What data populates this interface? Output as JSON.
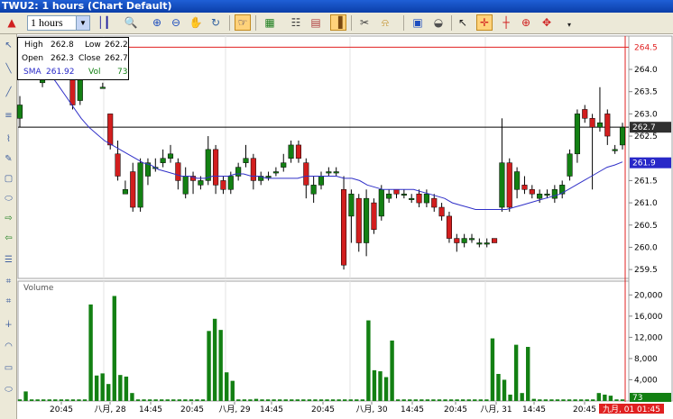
{
  "window": {
    "title": "TWU2: 1 hours (Chart Default)"
  },
  "toolbar": {
    "interval": "1 hours",
    "buttons": [
      "pin-icon",
      "bar-type-icon",
      "zoom-icon",
      "zoom-in-icon",
      "zoom-out-icon",
      "pan-icon",
      "refresh-icon",
      "cursor-icon",
      "indicator-icon",
      "grid-icon",
      "color-icon",
      "scissors-icon",
      "alert-icon",
      "save-icon",
      "eraser-icon",
      "pointer-icon",
      "crosshair-icon",
      "cross-red-icon",
      "cross-dot-icon",
      "cross-arrow-icon"
    ]
  },
  "info": {
    "high_label": "High",
    "high": "262.8",
    "low_label": "Low",
    "low": "262.2",
    "open_label": "Open",
    "open": "262.3",
    "close_label": "Close",
    "close": "262.7",
    "sma_label": "SMA",
    "sma": "261.92",
    "vol_label": "Vol",
    "vol": "73"
  },
  "price_axis": {
    "ticks": [
      "264.0",
      "263.5",
      "263.0",
      "262.5",
      "261.5",
      "261.0",
      "260.5",
      "260.0",
      "259.5"
    ],
    "last_close": "262.7",
    "sma_tag": "261.9",
    "alert": "264.5"
  },
  "volume_axis": {
    "ticks": [
      "20,000",
      "16,000",
      "12,000",
      "8,000",
      "4,000"
    ],
    "last": "73"
  },
  "volume_label": "Volume",
  "time_axis": [
    "20:45",
    "八月, 28",
    "14:45",
    "20:45",
    "八月, 29",
    "14:45",
    "20:45",
    "八月, 30",
    "14:45",
    "20:45",
    "八月, 31",
    "14:45",
    "20:45"
  ],
  "time_cursor": "九月, 01 01:45",
  "colors": {
    "up": "#138013",
    "down": "#d21e1e",
    "sma": "#3030c8",
    "volume": "#138013",
    "alert": "#e02020",
    "close_tag": "#303030",
    "sma_tag": "#2828c8"
  },
  "chart_data": {
    "type": "candlestick",
    "ylim": [
      259.3,
      264.75
    ],
    "ohlc": [
      [
        262.9,
        263.2,
        262.7,
        263.4
      ],
      [
        264.1,
        264.3,
        264.0,
        264.5
      ],
      [
        264.1,
        263.9,
        263.8,
        264.2
      ],
      [
        263.7,
        264.0,
        263.6,
        264.1
      ],
      [
        264.3,
        264.3,
        264.3,
        264.4
      ],
      [
        264.3,
        264.3,
        264.3,
        264.4
      ],
      [
        264.1,
        264.1,
        264.0,
        264.3
      ],
      [
        263.9,
        263.2,
        263.1,
        264.4
      ],
      [
        263.3,
        263.8,
        263.2,
        264.1
      ],
      [
        264.4,
        264.2,
        264.1,
        264.5
      ],
      [
        264.5,
        264.6,
        264.0,
        264.7
      ],
      [
        263.6,
        263.6,
        263.6,
        263.7
      ],
      [
        263.0,
        262.3,
        262.2,
        263.0
      ],
      [
        262.1,
        261.6,
        261.5,
        262.4
      ],
      [
        261.2,
        261.3,
        261.2,
        261.5
      ],
      [
        261.7,
        260.9,
        260.8,
        261.9
      ],
      [
        260.9,
        261.9,
        260.8,
        262.0
      ],
      [
        261.6,
        261.9,
        261.4,
        262.0
      ],
      [
        261.8,
        261.8,
        261.7,
        262.0
      ],
      [
        261.9,
        262.0,
        261.8,
        262.2
      ],
      [
        262.0,
        262.1,
        261.9,
        262.3
      ],
      [
        261.9,
        261.5,
        261.3,
        262.0
      ],
      [
        261.2,
        261.6,
        261.1,
        261.8
      ],
      [
        261.6,
        261.5,
        261.2,
        261.7
      ],
      [
        261.4,
        261.5,
        261.3,
        261.6
      ],
      [
        261.5,
        262.2,
        261.4,
        262.5
      ],
      [
        262.2,
        261.4,
        261.2,
        262.3
      ],
      [
        261.5,
        261.3,
        261.2,
        261.6
      ],
      [
        261.3,
        261.6,
        261.2,
        261.7
      ],
      [
        261.6,
        261.8,
        261.5,
        261.9
      ],
      [
        261.9,
        262.0,
        261.8,
        262.3
      ],
      [
        262.0,
        261.5,
        261.3,
        262.1
      ],
      [
        261.5,
        261.6,
        261.4,
        261.7
      ],
      [
        261.6,
        261.6,
        261.5,
        261.7
      ],
      [
        261.7,
        261.7,
        261.6,
        261.8
      ],
      [
        261.8,
        261.9,
        261.7,
        262.1
      ],
      [
        262.0,
        262.3,
        261.9,
        262.4
      ],
      [
        262.3,
        262.0,
        261.9,
        262.4
      ],
      [
        261.9,
        261.4,
        261.1,
        262.0
      ],
      [
        261.2,
        261.4,
        261.0,
        261.6
      ],
      [
        261.4,
        261.6,
        261.3,
        261.7
      ],
      [
        261.7,
        261.7,
        261.6,
        261.8
      ],
      [
        261.7,
        261.7,
        261.6,
        261.8
      ],
      [
        261.3,
        259.6,
        259.5,
        261.6
      ],
      [
        260.7,
        261.2,
        260.1,
        261.3
      ],
      [
        261.1,
        260.1,
        259.9,
        261.2
      ],
      [
        260.1,
        261.1,
        259.8,
        261.3
      ],
      [
        261.0,
        260.4,
        260.3,
        261.1
      ],
      [
        260.7,
        261.3,
        260.6,
        261.4
      ],
      [
        261.1,
        261.2,
        261.0,
        261.3
      ],
      [
        261.3,
        261.2,
        261.1,
        261.3
      ],
      [
        261.2,
        261.2,
        261.1,
        261.3
      ],
      [
        261.1,
        261.1,
        261.0,
        261.2
      ],
      [
        261.2,
        261.0,
        260.9,
        261.3
      ],
      [
        261.0,
        261.2,
        260.9,
        261.3
      ],
      [
        261.1,
        260.9,
        260.8,
        261.2
      ],
      [
        260.9,
        260.7,
        260.6,
        261.0
      ],
      [
        260.7,
        260.2,
        260.1,
        260.8
      ],
      [
        260.2,
        260.1,
        259.9,
        260.3
      ],
      [
        260.1,
        260.2,
        260.0,
        260.3
      ],
      [
        260.2,
        260.2,
        260.1,
        260.3
      ],
      [
        260.1,
        260.1,
        260.0,
        260.2
      ],
      [
        260.1,
        260.1,
        260.0,
        260.2
      ],
      [
        260.2,
        260.1,
        260.1,
        260.2
      ],
      [
        260.9,
        261.9,
        260.8,
        262.9
      ],
      [
        261.9,
        260.9,
        260.8,
        262.0
      ],
      [
        261.3,
        261.7,
        261.1,
        261.8
      ],
      [
        261.4,
        261.3,
        261.2,
        261.6
      ],
      [
        261.3,
        261.2,
        261.1,
        261.4
      ],
      [
        261.1,
        261.2,
        261.0,
        261.3
      ],
      [
        261.2,
        261.2,
        261.1,
        261.3
      ],
      [
        261.1,
        261.3,
        261.0,
        261.4
      ],
      [
        261.2,
        261.4,
        261.1,
        261.5
      ],
      [
        261.6,
        262.1,
        261.5,
        262.2
      ],
      [
        262.1,
        263.0,
        261.9,
        263.1
      ],
      [
        263.1,
        262.9,
        262.8,
        263.2
      ],
      [
        262.9,
        262.7,
        261.3,
        263.0
      ],
      [
        262.7,
        262.8,
        262.6,
        263.6
      ],
      [
        263.0,
        262.5,
        262.3,
        263.1
      ],
      [
        262.2,
        262.2,
        262.1,
        262.3
      ],
      [
        262.3,
        262.7,
        262.2,
        262.8
      ]
    ],
    "sma": [
      264.0,
      264.15,
      264.1,
      263.9,
      263.65,
      263.4,
      263.15,
      262.9,
      262.7,
      262.55,
      262.4,
      262.3,
      262.2,
      262.1,
      262.0,
      261.9,
      261.85,
      261.75,
      261.7,
      261.65,
      261.6,
      261.6,
      261.55,
      261.55,
      261.6,
      261.6,
      261.6,
      261.65,
      261.65,
      261.6,
      261.6,
      261.55,
      261.55,
      261.55,
      261.55,
      261.55,
      261.6,
      261.6,
      261.6,
      261.6,
      261.6,
      261.55,
      261.55,
      261.5,
      261.4,
      261.35,
      261.3,
      261.3,
      261.3,
      261.3,
      261.3,
      261.25,
      261.2,
      261.15,
      261.1,
      261.0,
      260.95,
      260.9,
      260.85,
      260.85,
      260.85,
      260.85,
      260.85,
      260.9,
      260.95,
      261.0,
      261.05,
      261.1,
      261.15,
      261.2,
      261.3,
      261.4,
      261.5,
      261.6,
      261.7,
      261.8,
      261.85,
      261.92
    ],
    "volume": [
      300,
      1800,
      300,
      300,
      300,
      300,
      300,
      300,
      300,
      300,
      300,
      300,
      18200,
      4800,
      5200,
      3200,
      19800,
      4900,
      4600,
      1500,
      300,
      300,
      300,
      300,
      300,
      300,
      300,
      300,
      300,
      300,
      300,
      300,
      13200,
      15500,
      13400,
      5400,
      3800,
      300,
      300,
      300,
      400,
      300,
      300,
      300,
      300,
      300,
      300,
      300,
      300,
      300,
      300,
      300,
      300,
      300,
      300,
      300,
      300,
      300,
      300,
      15200,
      5800,
      5600,
      4500,
      11400,
      300,
      300,
      300,
      300,
      300,
      300,
      300,
      300,
      300,
      300,
      300,
      300,
      300,
      300,
      300,
      300,
      11800,
      5100,
      4000,
      1200,
      10600,
      1500,
      10200,
      400,
      300,
      300,
      300,
      300,
      300,
      300,
      300,
      300,
      300,
      300,
      1500,
      1200,
      1000,
      300,
      300
    ],
    "vol_ylim": [
      0,
      22600
    ]
  }
}
